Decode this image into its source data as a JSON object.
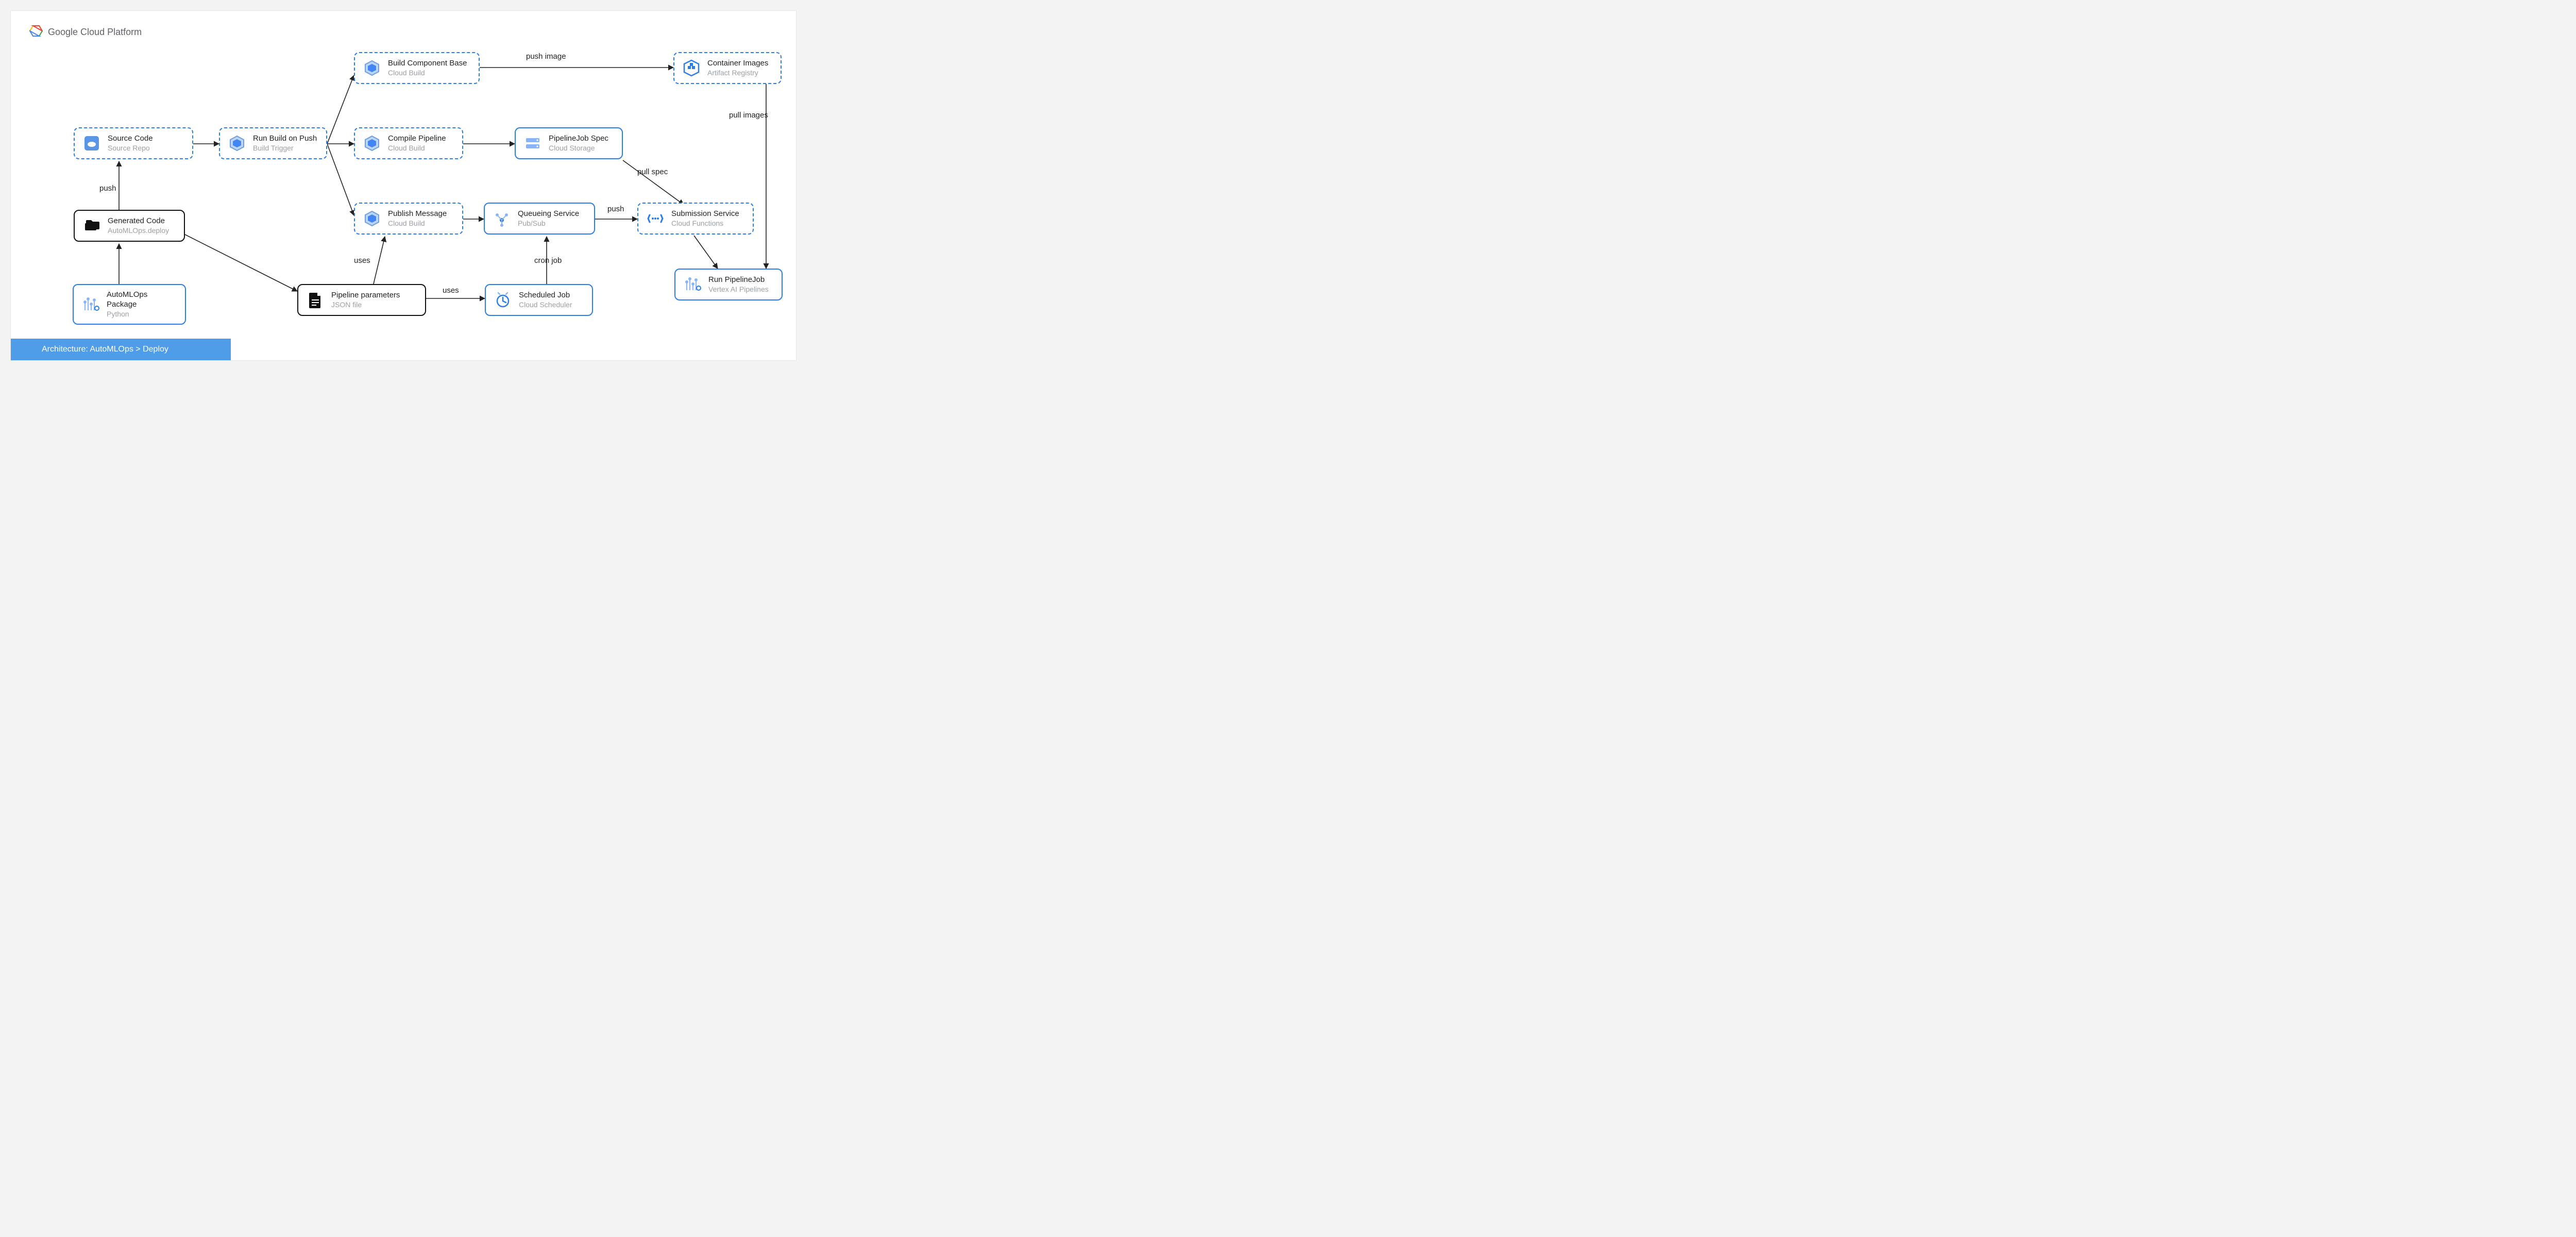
{
  "brand": {
    "name_bold": "Google",
    "name_rest": " Cloud Platform"
  },
  "footer": "Architecture: AutoMLOps > Deploy",
  "nodes": {
    "source_code": {
      "title": "Source Code",
      "sub": "Source Repo"
    },
    "run_build": {
      "title": "Run Build on Push",
      "sub": "Build Trigger"
    },
    "build_component": {
      "title": "Build Component Base",
      "sub": "Cloud Build"
    },
    "compile_pipeline": {
      "title": "Compile Pipeline",
      "sub": "Cloud Build"
    },
    "publish_message": {
      "title": "Publish Message",
      "sub": "Cloud Build"
    },
    "container_images": {
      "title": "Container Images",
      "sub": "Artifact Registry"
    },
    "pipelinejob_spec": {
      "title": "PipelineJob Spec",
      "sub": "Cloud Storage"
    },
    "queueing": {
      "title": "Queueing Service",
      "sub": "Pub/Sub"
    },
    "submission": {
      "title": "Submission Service",
      "sub": "Cloud Functions"
    },
    "run_pipelinejob": {
      "title": "Run PipelineJob",
      "sub": "Vertex AI Pipelines"
    },
    "scheduled_job": {
      "title": "Scheduled Job",
      "sub": "Cloud Scheduler"
    },
    "pipeline_params": {
      "title": "Pipeline parameters",
      "sub": "JSON file"
    },
    "automlops_pkg": {
      "title": "AutoMLOps Package",
      "sub": "Python"
    },
    "generated_code": {
      "title": "Generated Code",
      "sub": "AutoMLOps.deploy"
    }
  },
  "edges": {
    "push": "push",
    "push_image": "push image",
    "pull_images": "pull images",
    "pull_spec": "pull spec",
    "push2": "push",
    "uses1": "uses",
    "uses2": "uses",
    "cron_job": "cron job"
  }
}
